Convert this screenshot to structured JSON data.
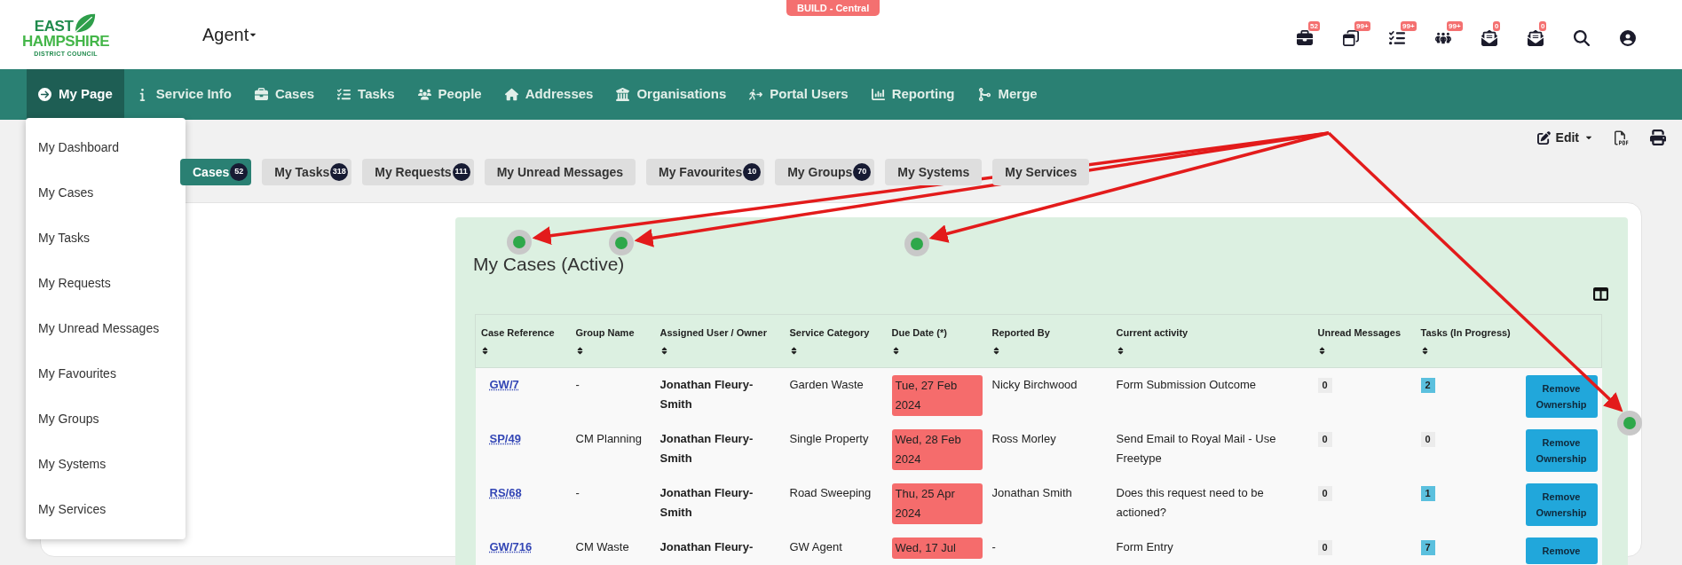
{
  "logo": {
    "lines": [
      "EAST",
      "HAMPSHIRE",
      "DISTRICT COUNCIL"
    ]
  },
  "role_menu": {
    "label": "Agent"
  },
  "environment_badge": "BUILD - Central",
  "header_icons": [
    {
      "kind": "cases",
      "badge": "52"
    },
    {
      "kind": "windows",
      "badge": "99+"
    },
    {
      "kind": "tasks",
      "badge": "99+"
    },
    {
      "kind": "people",
      "badge": "99+"
    },
    {
      "kind": "mail",
      "badge": "0"
    },
    {
      "kind": "mail",
      "badge": "0"
    },
    {
      "kind": "search"
    },
    {
      "kind": "user"
    }
  ],
  "nav": [
    {
      "kind": "mypage",
      "label": "My Page",
      "selected": true
    },
    {
      "kind": "info",
      "label": "Service Info",
      "selected": false
    },
    {
      "kind": "cases",
      "label": "Cases",
      "selected": false
    },
    {
      "kind": "tasks",
      "label": "Tasks",
      "selected": false
    },
    {
      "kind": "people",
      "label": "People",
      "selected": false
    },
    {
      "kind": "addresses",
      "label": "Addresses",
      "selected": false
    },
    {
      "kind": "organisations",
      "label": "Organisations",
      "selected": false
    },
    {
      "kind": "portal",
      "label": "Portal Users",
      "selected": false
    },
    {
      "kind": "reporting",
      "label": "Reporting",
      "selected": false
    },
    {
      "kind": "merge",
      "label": "Merge",
      "selected": false
    }
  ],
  "dropdown_menu": [
    "My Dashboard",
    "My Cases",
    "My Tasks",
    "My Requests",
    "My Unread Messages",
    "My Favourites",
    "My Groups",
    "My Systems",
    "My Services"
  ],
  "toolbar": {
    "edit_label": "Edit"
  },
  "tabs": [
    {
      "label": "Cases",
      "count": "52",
      "selected": true
    },
    {
      "label": "My Tasks",
      "count": "318",
      "selected": false
    },
    {
      "label": "My Requests",
      "count": "111",
      "selected": false
    },
    {
      "label": "My Unread Messages",
      "selected": false
    },
    {
      "label": "My Favourites",
      "count": "10",
      "selected": false
    },
    {
      "label": "My Groups",
      "count": "70",
      "selected": false
    },
    {
      "label": "My Systems",
      "selected": false
    },
    {
      "label": "My Services",
      "selected": false
    }
  ],
  "panel": {
    "title": "My Cases (Active)"
  },
  "table": {
    "columns": [
      "Case Reference",
      "Group Name",
      "Assigned User / Owner",
      "Service Category",
      "Due Date (*)",
      "Reported By",
      "Current activity",
      "Unread Messages",
      "Tasks (In Progress)"
    ],
    "rows": [
      {
        "reference": "GW/7",
        "group": "-",
        "owner": "Jonathan Fleury-Smith",
        "category": "Garden Waste",
        "due": "Tue, 27 Feb 2024",
        "overdue": true,
        "reported_by": "Nicky Birchwood",
        "activity": "Form Submission Outcome",
        "unread": "0",
        "tasks": "2",
        "tasks_highlighted": true,
        "action": "Remove Ownership"
      },
      {
        "reference": "SP/49",
        "group": "CM Planning",
        "owner": "Jonathan Fleury-Smith",
        "category": "Single Property",
        "due": "Wed, 28 Feb 2024",
        "overdue": true,
        "reported_by": "Ross Morley",
        "activity": "Send Email to Royal Mail - Use Freetype",
        "unread": "0",
        "tasks": "0",
        "tasks_highlighted": false,
        "action": "Remove Ownership"
      },
      {
        "reference": "RS/68",
        "group": "-",
        "owner": "Jonathan Fleury-Smith",
        "category": "Road Sweeping",
        "due": "Thu, 25 Apr 2024",
        "overdue": true,
        "reported_by": "Jonathan Smith",
        "activity": "Does this request need to be actioned?",
        "unread": "0",
        "tasks": "1",
        "tasks_highlighted": true,
        "action": "Remove Ownership"
      },
      {
        "reference": "GW/716",
        "group": "CM Waste",
        "owner": "Jonathan Fleury-",
        "category": "GW Agent",
        "due": "Wed, 17 Jul",
        "overdue": true,
        "reported_by": "-",
        "activity": "Form Entry",
        "unread": "0",
        "tasks": "7",
        "tasks_highlighted": true,
        "action": "Remove"
      }
    ]
  }
}
